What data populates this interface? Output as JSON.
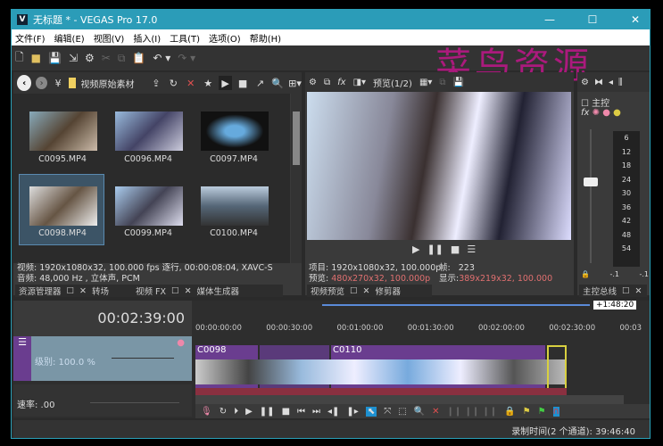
{
  "window": {
    "title": "无标题 * - VEGAS Pro 17.0",
    "logo": "V"
  },
  "menu": [
    "文件(F)",
    "编辑(E)",
    "视图(V)",
    "插入(I)",
    "工具(T)",
    "选项(O)",
    "帮助(H)"
  ],
  "watermark": "菜鸟资源",
  "explorer": {
    "folder": "视频原始素材",
    "files": [
      "C0095.MP4",
      "C0096.MP4",
      "C0097.MP4",
      "C0098.MP4",
      "C0099.MP4",
      "C0100.MP4"
    ],
    "selected": "C0098.MP4",
    "video_info": "视频: 1920x1080x32, 100.000 fps 逐行, 00:00:08:04, XAVC-S",
    "audio_info": "音频: 48,000 Hz , 立体声, PCM",
    "tabs": [
      "资源管理器",
      "转场",
      "视频 FX",
      "媒体生成器"
    ]
  },
  "preview": {
    "mode": "预览(1/2)",
    "project_label": "项目:",
    "project": "1920x1080x32, 100.000p",
    "preview_label": "预览:",
    "preview": "480x270x32, 100.000p",
    "frame_label": "帧:",
    "frame": "223",
    "display_label": "显示:",
    "display": "389x219x32, 100.000",
    "tabs": [
      "视频预览",
      "修剪器"
    ]
  },
  "master": {
    "label": "主控",
    "scale": [
      "6",
      "12",
      "18",
      "24",
      "30",
      "36",
      "42",
      "48",
      "54"
    ],
    "peaks": [
      "-.1",
      "-.1"
    ],
    "tab": "主控总线"
  },
  "timeline": {
    "time": "00:02:39:00",
    "loop_len": "+1:48:20",
    "ruler": [
      "00:00:00:00",
      "00:00:30:00",
      "00:01:00:00",
      "00:01:30:00",
      "00:02:00:00",
      "00:02:30:00",
      "00:03"
    ],
    "track_level": "级别: 100.0 %",
    "rate": "速率: .00",
    "clips": [
      "C0098",
      "C0110"
    ]
  },
  "status": {
    "record_time": "录制时间(2 个通道): 39:46:40"
  },
  "colors": {
    "accent": "#2b9cb8",
    "video_clip": "#6a3d8f",
    "audio_clip": "#8a3040",
    "track_header": "#7a96a6"
  }
}
